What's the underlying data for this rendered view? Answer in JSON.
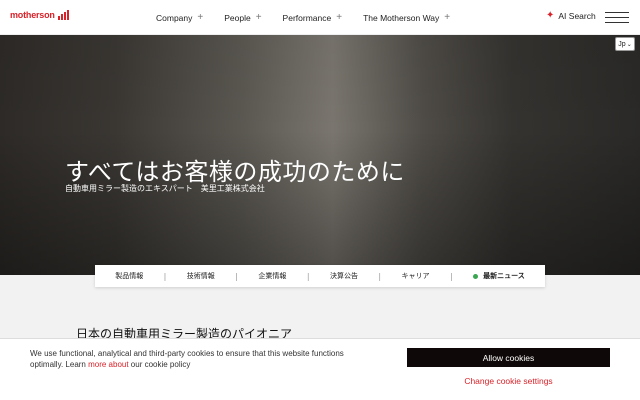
{
  "header": {
    "logo_text": "motherson",
    "nav": [
      {
        "label": "Company",
        "icon": "plus-icon"
      },
      {
        "label": "People",
        "icon": "plus-icon"
      },
      {
        "label": "Performance",
        "icon": "plus-icon"
      },
      {
        "label": "The Motherson Way",
        "icon": "plus-icon"
      }
    ],
    "ai_search_label": "AI Search",
    "brand_color": "#d8232a"
  },
  "hero": {
    "language_selected": "Jp",
    "title": "すべてはお客様の成功のために",
    "subtitle": "自動車用ミラー製造のエキスパート　美里工業株式会社"
  },
  "subnav": {
    "items": [
      {
        "label": "製品情報"
      },
      {
        "label": "技術情報"
      },
      {
        "label": "企業情報"
      },
      {
        "label": "決算公告"
      },
      {
        "label": "キャリア"
      },
      {
        "label": "最新ニュース"
      }
    ]
  },
  "section": {
    "title": "日本の自動車用ミラー製造のパイオニア"
  },
  "cookie": {
    "text_before": "We use functional, analytical and third-party cookies to ensure that this website functions optimally. Learn ",
    "link": "more about",
    "text_after": " our cookie policy",
    "allow_label": "Allow cookies",
    "change_label": "Change cookie settings"
  }
}
